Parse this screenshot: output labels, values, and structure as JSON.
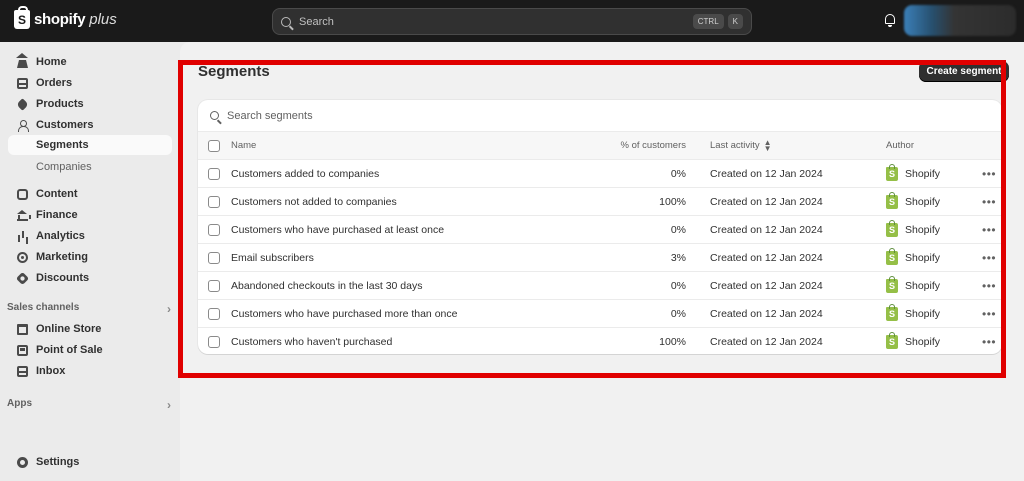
{
  "topbar": {
    "logo_text": "shopify",
    "logo_plus": "plus",
    "search_placeholder": "Search",
    "shortcut_ctrl": "CTRL",
    "shortcut_k": "K"
  },
  "sidebar": {
    "items": [
      {
        "label": "Home",
        "icon": "home-icon"
      },
      {
        "label": "Orders",
        "icon": "orders-icon"
      },
      {
        "label": "Products",
        "icon": "tag-icon"
      },
      {
        "label": "Customers",
        "icon": "person-icon"
      },
      {
        "label": "Segments"
      },
      {
        "label": "Companies"
      },
      {
        "label": "Content",
        "icon": "content-icon"
      },
      {
        "label": "Finance",
        "icon": "bank-icon"
      },
      {
        "label": "Analytics",
        "icon": "bar-chart-icon"
      },
      {
        "label": "Marketing",
        "icon": "target-icon"
      },
      {
        "label": "Discounts",
        "icon": "discount-icon"
      }
    ],
    "sales_channels_label": "Sales channels",
    "channels": [
      {
        "label": "Online Store",
        "icon": "store-icon"
      },
      {
        "label": "Point of Sale",
        "icon": "pos-icon"
      },
      {
        "label": "Inbox",
        "icon": "inbox-icon"
      }
    ],
    "apps_label": "Apps",
    "settings_label": "Settings"
  },
  "main": {
    "title": "Segments",
    "create_button": "Create segment",
    "search_placeholder": "Search segments",
    "columns": {
      "name": "Name",
      "pct": "% of customers",
      "activity": "Last activity",
      "author": "Author"
    },
    "rows": [
      {
        "name": "Customers added to companies",
        "pct": "0%",
        "activity": "Created on 12 Jan 2024",
        "author": "Shopify"
      },
      {
        "name": "Customers not added to companies",
        "pct": "100%",
        "activity": "Created on 12 Jan 2024",
        "author": "Shopify"
      },
      {
        "name": "Customers who have purchased at least once",
        "pct": "0%",
        "activity": "Created on 12 Jan 2024",
        "author": "Shopify"
      },
      {
        "name": "Email subscribers",
        "pct": "3%",
        "activity": "Created on 12 Jan 2024",
        "author": "Shopify"
      },
      {
        "name": "Abandoned checkouts in the last 30 days",
        "pct": "0%",
        "activity": "Created on 12 Jan 2024",
        "author": "Shopify"
      },
      {
        "name": "Customers who have purchased more than once",
        "pct": "0%",
        "activity": "Created on 12 Jan 2024",
        "author": "Shopify"
      },
      {
        "name": "Customers who haven't purchased",
        "pct": "100%",
        "activity": "Created on 12 Jan 2024",
        "author": "Shopify"
      }
    ],
    "more_glyph": "•••"
  },
  "colors": {
    "topbar": "#1a1a1a",
    "highlight": "#e00000",
    "shopify_green": "#95bf47"
  }
}
